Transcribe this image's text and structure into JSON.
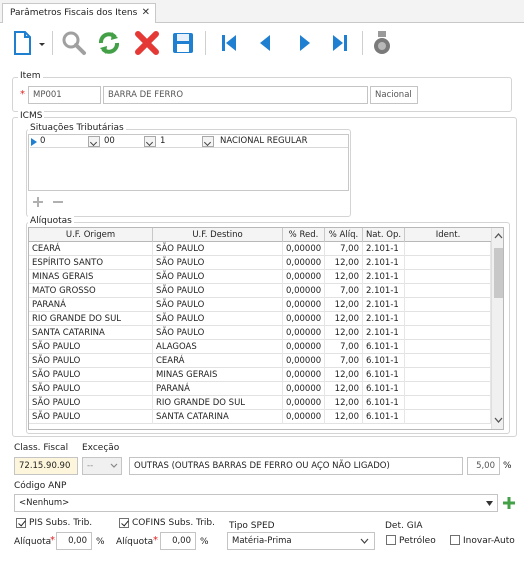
{
  "tab": {
    "title": "Parâmetros Fiscais dos Itens",
    "close": "✕"
  },
  "toolbar": {
    "icons": [
      "new-document-icon",
      "dropdown-arrow-icon",
      "search-icon",
      "refresh-icon",
      "delete-icon",
      "save-icon",
      "first-record-icon",
      "previous-record-icon",
      "next-record-icon",
      "last-record-icon",
      "report-icon"
    ]
  },
  "item": {
    "legend": "Item",
    "code": "MP001",
    "description": "BARRA DE FERRO",
    "origin": "Nacional"
  },
  "icms": {
    "legend": "ICMS",
    "situations": {
      "legend": "Situações Tributárias",
      "row": {
        "col1": "0",
        "col2": "00",
        "col3": "1",
        "col4": "NACIONAL REGULAR"
      }
    },
    "aliquotas": {
      "legend": "Alíquotas",
      "headers": [
        "U.F. Origem",
        "U.F. Destino",
        "% Red.",
        "% Alíq.",
        "Nat. Op.",
        "Ident."
      ],
      "rows": [
        [
          "CEARÁ",
          "SÃO PAULO",
          "0,00000",
          "7,00",
          "2.101-1",
          ""
        ],
        [
          "ESPÍRITO SANTO",
          "SÃO PAULO",
          "0,00000",
          "12,00",
          "2.101-1",
          ""
        ],
        [
          "MINAS GERAIS",
          "SÃO PAULO",
          "0,00000",
          "12,00",
          "2.101-1",
          ""
        ],
        [
          "MATO GROSSO",
          "SÃO PAULO",
          "0,00000",
          "7,00",
          "2.101-1",
          ""
        ],
        [
          "PARANÁ",
          "SÃO PAULO",
          "0,00000",
          "12,00",
          "2.101-1",
          ""
        ],
        [
          "RIO GRANDE DO SUL",
          "SÃO PAULO",
          "0,00000",
          "12,00",
          "2.101-1",
          ""
        ],
        [
          "SANTA CATARINA",
          "SÃO PAULO",
          "0,00000",
          "12,00",
          "2.101-1",
          ""
        ],
        [
          "SÃO PAULO",
          "ALAGOAS",
          "0,00000",
          "7,00",
          "6.101-1",
          ""
        ],
        [
          "SÃO PAULO",
          "CEARÁ",
          "0,00000",
          "7,00",
          "6.101-1",
          ""
        ],
        [
          "SÃO PAULO",
          "MINAS GERAIS",
          "0,00000",
          "12,00",
          "6.101-1",
          ""
        ],
        [
          "SÃO PAULO",
          "PARANÁ",
          "0,00000",
          "12,00",
          "6.101-1",
          ""
        ],
        [
          "SÃO PAULO",
          "RIO GRANDE DO SUL",
          "0,00000",
          "12,00",
          "6.101-1",
          ""
        ],
        [
          "SÃO PAULO",
          "SANTA CATARINA",
          "0,00000",
          "12,00",
          "6.101-1",
          ""
        ]
      ]
    }
  },
  "fiscal": {
    "class_label": "Class. Fiscal",
    "class_value": "72.15.90.90",
    "exception_label": "Exceção",
    "exception_value": "--",
    "description": "OUTRAS (OUTRAS BARRAS DE FERRO OU AÇO NÃO LIGADO)",
    "percent": "5,00",
    "percent_unit": "%"
  },
  "anp": {
    "label": "Código ANP",
    "value": "<Nenhum>"
  },
  "pis": {
    "label": "PIS Subs. Trib.",
    "aliquota_label": "Alíquota",
    "value": "0,00",
    "unit": "%"
  },
  "cofins": {
    "label": "COFINS Subs. Trib.",
    "aliquota_label": "Alíquota",
    "value": "0,00",
    "unit": "%"
  },
  "sped": {
    "label": "Tipo SPED",
    "value": "Matéria-Prima"
  },
  "gia": {
    "label": "Det. GIA",
    "petroleo": "Petróleo",
    "inovar": "Inovar-Auto"
  },
  "colors": {
    "accent": "#1f7fd1",
    "delete": "#e53935",
    "refresh": "#43a047",
    "required": "#e02020",
    "highlight_field": "#fdf6dc"
  }
}
